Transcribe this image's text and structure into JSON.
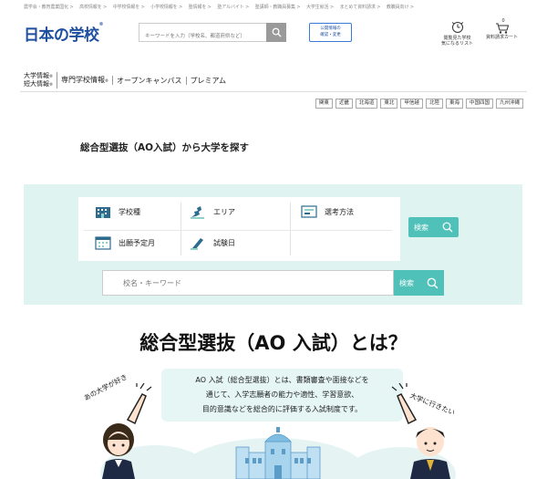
{
  "header": {
    "top_links": [
      "農学会・教育農業国化 >",
      "高校情報を >",
      "中学校情報を >",
      "小学校情報を >",
      "塾情報を >",
      "塾アルバイト >",
      "塾講師・教職員募集 >",
      "大学生就活 >",
      "まとめて資料請求 >",
      "教職員向け >"
    ],
    "logo_text": "日本の学校",
    "logo_mark": "®",
    "search_placeholder": "キーワードを入力（学校名、都道府県など）",
    "notice_line1": "公開情報の",
    "notice_line2": "確認・変更",
    "favorites_line1": "閲覧見た学校",
    "favorites_line2": "気になるリスト",
    "cart_label": "資料請求カート",
    "cart_count": "0"
  },
  "nav": {
    "items": [
      {
        "line1": "大学情報",
        "line2": "短大情報",
        "mark": "®"
      },
      {
        "label": "専門学校情報",
        "mark": "®"
      },
      {
        "label": "オープンキャンパス"
      },
      {
        "label": "プレミアム"
      }
    ]
  },
  "regions": [
    "関東",
    "近畿",
    "北海道",
    "東北",
    "甲信越",
    "北陸",
    "東海",
    "中国四国",
    "九州沖縄"
  ],
  "page_title": "総合型選抜（AO入試）から大学を探す",
  "search_panel": {
    "filters": [
      {
        "label": "学校種",
        "icon": "school-building-icon"
      },
      {
        "label": "エリア",
        "icon": "area-map-icon"
      },
      {
        "label": "選考方法",
        "icon": "selection-method-icon"
      },
      {
        "label": "出願予定月",
        "icon": "calendar-icon"
      },
      {
        "label": "試験日",
        "icon": "exam-pencil-icon"
      }
    ],
    "filter_search_label": "検索",
    "keyword_placeholder": "校名・キーワード",
    "keyword_search_label": "検索"
  },
  "section": {
    "heading": "総合型選抜（AO 入試）とは？",
    "description": [
      "AO 入試（総合型選抜）とは、書類審査や面接などを",
      "通じて、入学志願者の能力や適性、学習意欲、",
      "目的意識などを総合的に評価する入試制度です。"
    ],
    "left_caption": "あの大学が好き",
    "right_caption": "大学に行きたい"
  },
  "colors": {
    "brand": "#1e4fa0",
    "accent": "#4fc1b9",
    "panel": "#dff3f1"
  }
}
